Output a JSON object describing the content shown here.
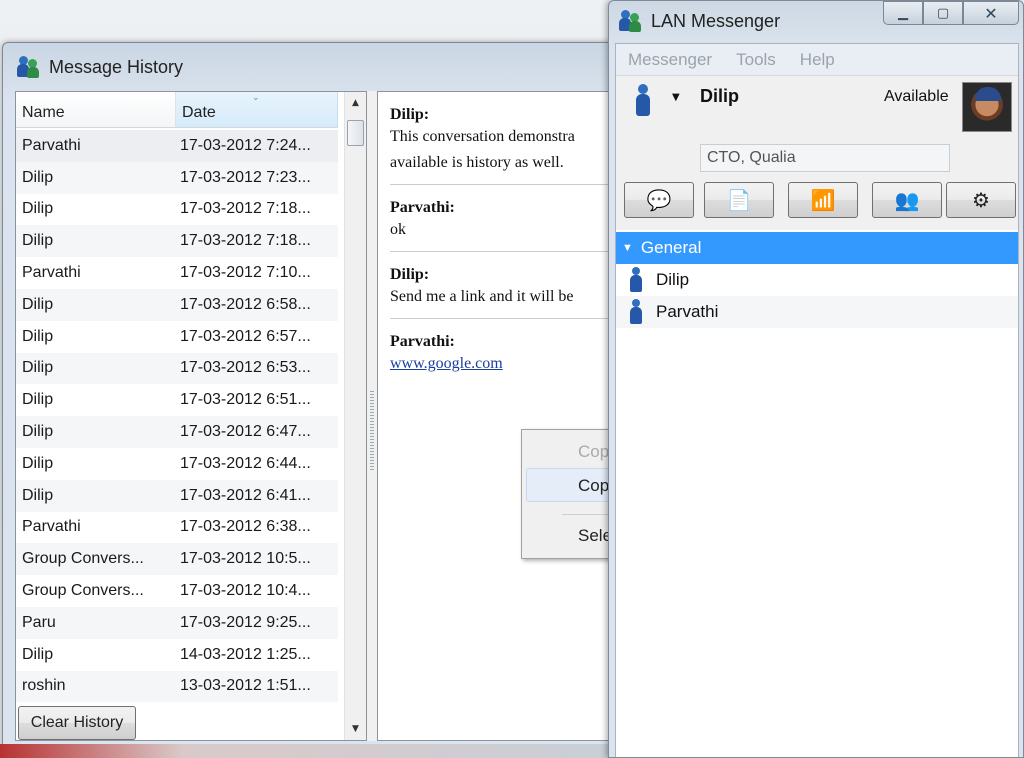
{
  "history_window": {
    "title": "Message History",
    "columns": {
      "name": "Name",
      "date": "Date"
    },
    "rows": [
      {
        "name": "Parvathi",
        "date": "17-03-2012 7:24..."
      },
      {
        "name": "Dilip",
        "date": "17-03-2012 7:23..."
      },
      {
        "name": "Dilip",
        "date": "17-03-2012 7:18..."
      },
      {
        "name": "Dilip",
        "date": "17-03-2012 7:18..."
      },
      {
        "name": "Parvathi",
        "date": "17-03-2012 7:10..."
      },
      {
        "name": "Dilip",
        "date": "17-03-2012 6:58..."
      },
      {
        "name": "Dilip",
        "date": "17-03-2012 6:57..."
      },
      {
        "name": "Dilip",
        "date": "17-03-2012 6:53..."
      },
      {
        "name": "Dilip",
        "date": "17-03-2012 6:51..."
      },
      {
        "name": "Dilip",
        "date": "17-03-2012 6:47..."
      },
      {
        "name": "Dilip",
        "date": "17-03-2012 6:44..."
      },
      {
        "name": "Dilip",
        "date": "17-03-2012 6:41..."
      },
      {
        "name": "Parvathi",
        "date": "17-03-2012 6:38..."
      },
      {
        "name": "Group Convers...",
        "date": "17-03-2012 10:5..."
      },
      {
        "name": "Group Convers...",
        "date": "17-03-2012 10:4..."
      },
      {
        "name": "Paru",
        "date": "17-03-2012 9:25..."
      },
      {
        "name": "Dilip",
        "date": "14-03-2012 1:25..."
      },
      {
        "name": "roshin",
        "date": "13-03-2012 1:51..."
      }
    ],
    "messages": [
      {
        "sender": "Dilip:",
        "lines": [
          "This conversation demonstra",
          "available is history as well."
        ]
      },
      {
        "sender": "Parvathi:",
        "lines": [
          "ok"
        ]
      },
      {
        "sender": "Dilip:",
        "lines": [
          "Send me a link and it will be"
        ]
      },
      {
        "sender": "Parvathi:",
        "link": "www.google.com"
      }
    ],
    "context_menu": {
      "items": [
        "Cop",
        "Cop",
        "Sele"
      ]
    },
    "clear_button": "Clear History"
  },
  "lan_window": {
    "title": "LAN Messenger",
    "menu": [
      "Messenger",
      "Tools",
      "Help"
    ],
    "user": {
      "name": "Dilip",
      "status": "Available",
      "note": "CTO, Qualia"
    },
    "group": {
      "name": "General",
      "contacts": [
        "Dilip",
        "Parvathi"
      ]
    },
    "colors": {
      "group_header": "#3399ff",
      "link": "#1a3ea0"
    },
    "toolbar_icons": [
      "chat-icon",
      "file-transfer-icon",
      "broadcast-icon",
      "add-contact-icon",
      "settings-icon"
    ]
  }
}
